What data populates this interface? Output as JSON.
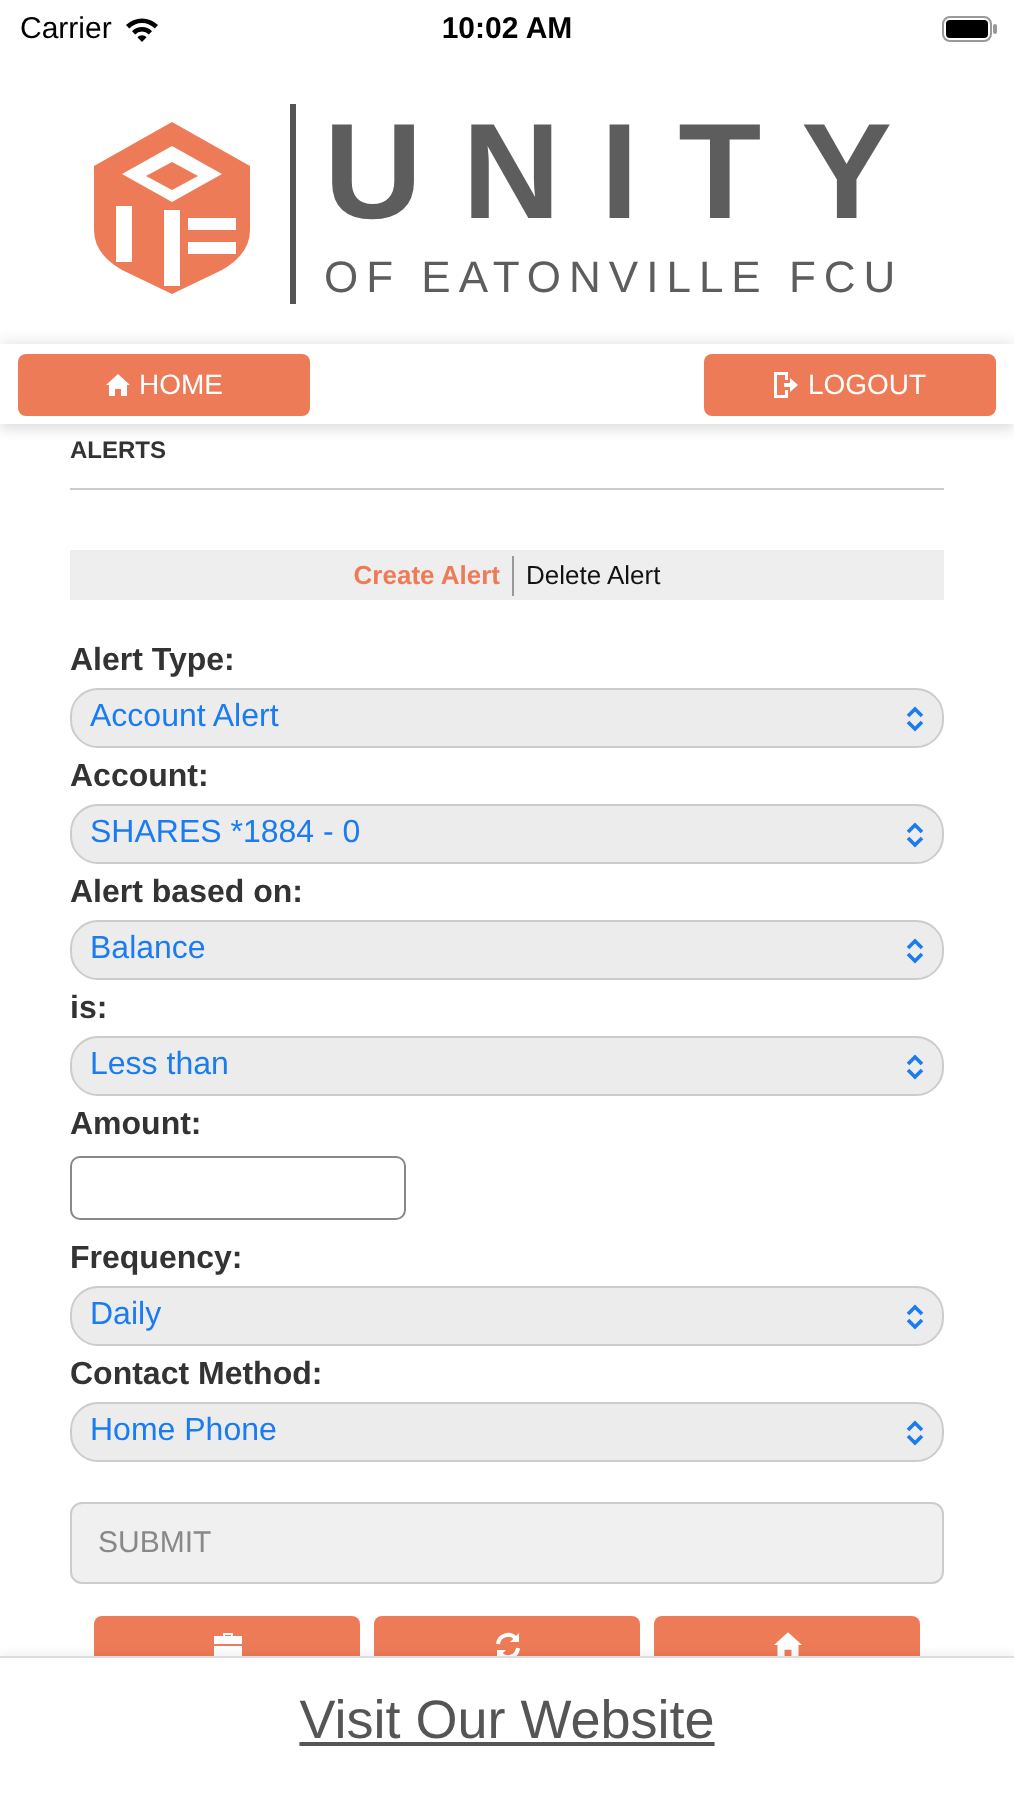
{
  "status_bar": {
    "carrier": "Carrier",
    "time": "10:02 AM"
  },
  "logo": {
    "title": "UNITY",
    "subtitle": "OF EATONVILLE FCU"
  },
  "nav": [
    {
      "label": "HOME",
      "kind": "home"
    },
    {
      "label": "LOGOUT",
      "kind": "logout"
    }
  ],
  "section_title": "ALERTS",
  "tabs": [
    {
      "label": "Create Alert",
      "selected": true
    },
    {
      "label": "Delete Alert",
      "selected": false
    }
  ],
  "fields": [
    {
      "label": "Alert Type:",
      "kind": "select",
      "value": "Account Alert"
    },
    {
      "label": "Account:",
      "kind": "select",
      "value": "SHARES *1884 - 0"
    },
    {
      "label": "Alert based on:",
      "kind": "select",
      "value": "Balance"
    },
    {
      "label": "is:",
      "kind": "select",
      "value": "Less than"
    },
    {
      "label": "Amount:",
      "kind": "input"
    },
    {
      "label": "Frequency:",
      "kind": "select",
      "value": "Daily"
    },
    {
      "label": "Contact Method:",
      "kind": "select",
      "value": "Home Phone"
    }
  ],
  "submit": {
    "label": "SUBMIT",
    "disabled": true
  },
  "bottom_buttons": [
    {
      "kind": "briefcase"
    },
    {
      "kind": "refresh"
    },
    {
      "kind": "home"
    }
  ],
  "footer": {
    "link": "Visit Our Website"
  }
}
